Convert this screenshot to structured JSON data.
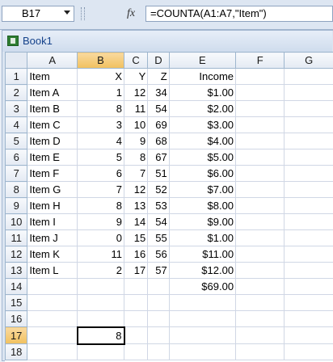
{
  "formula_bar": {
    "name_box": "B17",
    "fx_icon": "fx-icon",
    "formula": "=COUNTA(A1:A7,\"Item\")"
  },
  "workbook": {
    "title": "Book1",
    "icon": "excel-workbook-icon"
  },
  "sheet": {
    "columns": [
      "A",
      "B",
      "C",
      "D",
      "E",
      "F",
      "G"
    ],
    "selected_column": "B",
    "selected_row": 17,
    "rows": [
      {
        "n": "1",
        "cells": [
          "Item",
          "X",
          "Y",
          "Z",
          "Income",
          "",
          ""
        ]
      },
      {
        "n": "2",
        "cells": [
          "Item A",
          "1",
          "12",
          "34",
          "$1.00",
          "",
          ""
        ]
      },
      {
        "n": "3",
        "cells": [
          "Item B",
          "8",
          "11",
          "54",
          "$2.00",
          "",
          ""
        ]
      },
      {
        "n": "4",
        "cells": [
          "Item C",
          "3",
          "10",
          "69",
          "$3.00",
          "",
          ""
        ]
      },
      {
        "n": "5",
        "cells": [
          "Item D",
          "4",
          "9",
          "68",
          "$4.00",
          "",
          ""
        ]
      },
      {
        "n": "6",
        "cells": [
          "Item E",
          "5",
          "8",
          "67",
          "$5.00",
          "",
          ""
        ]
      },
      {
        "n": "7",
        "cells": [
          "Item F",
          "6",
          "7",
          "51",
          "$6.00",
          "",
          ""
        ]
      },
      {
        "n": "8",
        "cells": [
          "Item G",
          "7",
          "12",
          "52",
          "$7.00",
          "",
          ""
        ]
      },
      {
        "n": "9",
        "cells": [
          "Item H",
          "8",
          "13",
          "53",
          "$8.00",
          "",
          ""
        ]
      },
      {
        "n": "10",
        "cells": [
          "Item I",
          "9",
          "14",
          "54",
          "$9.00",
          "",
          ""
        ]
      },
      {
        "n": "11",
        "cells": [
          "Item J",
          "0",
          "15",
          "55",
          "$1.00",
          "",
          ""
        ]
      },
      {
        "n": "12",
        "cells": [
          "Item K",
          "11",
          "16",
          "56",
          "$11.00",
          "",
          ""
        ]
      },
      {
        "n": "13",
        "cells": [
          "Item L",
          "2",
          "17",
          "57",
          "$12.00",
          "",
          ""
        ]
      },
      {
        "n": "14",
        "cells": [
          "",
          "",
          "",
          "",
          "$69.00",
          "",
          ""
        ]
      },
      {
        "n": "15",
        "cells": [
          "",
          "",
          "",
          "",
          "",
          "",
          ""
        ]
      },
      {
        "n": "16",
        "cells": [
          "",
          "",
          "",
          "",
          "",
          "",
          ""
        ]
      },
      {
        "n": "17",
        "cells": [
          "",
          "8",
          "",
          "",
          "",
          "",
          ""
        ]
      },
      {
        "n": "18",
        "cells": [
          "",
          "",
          "",
          "",
          "",
          "",
          ""
        ]
      }
    ]
  }
}
